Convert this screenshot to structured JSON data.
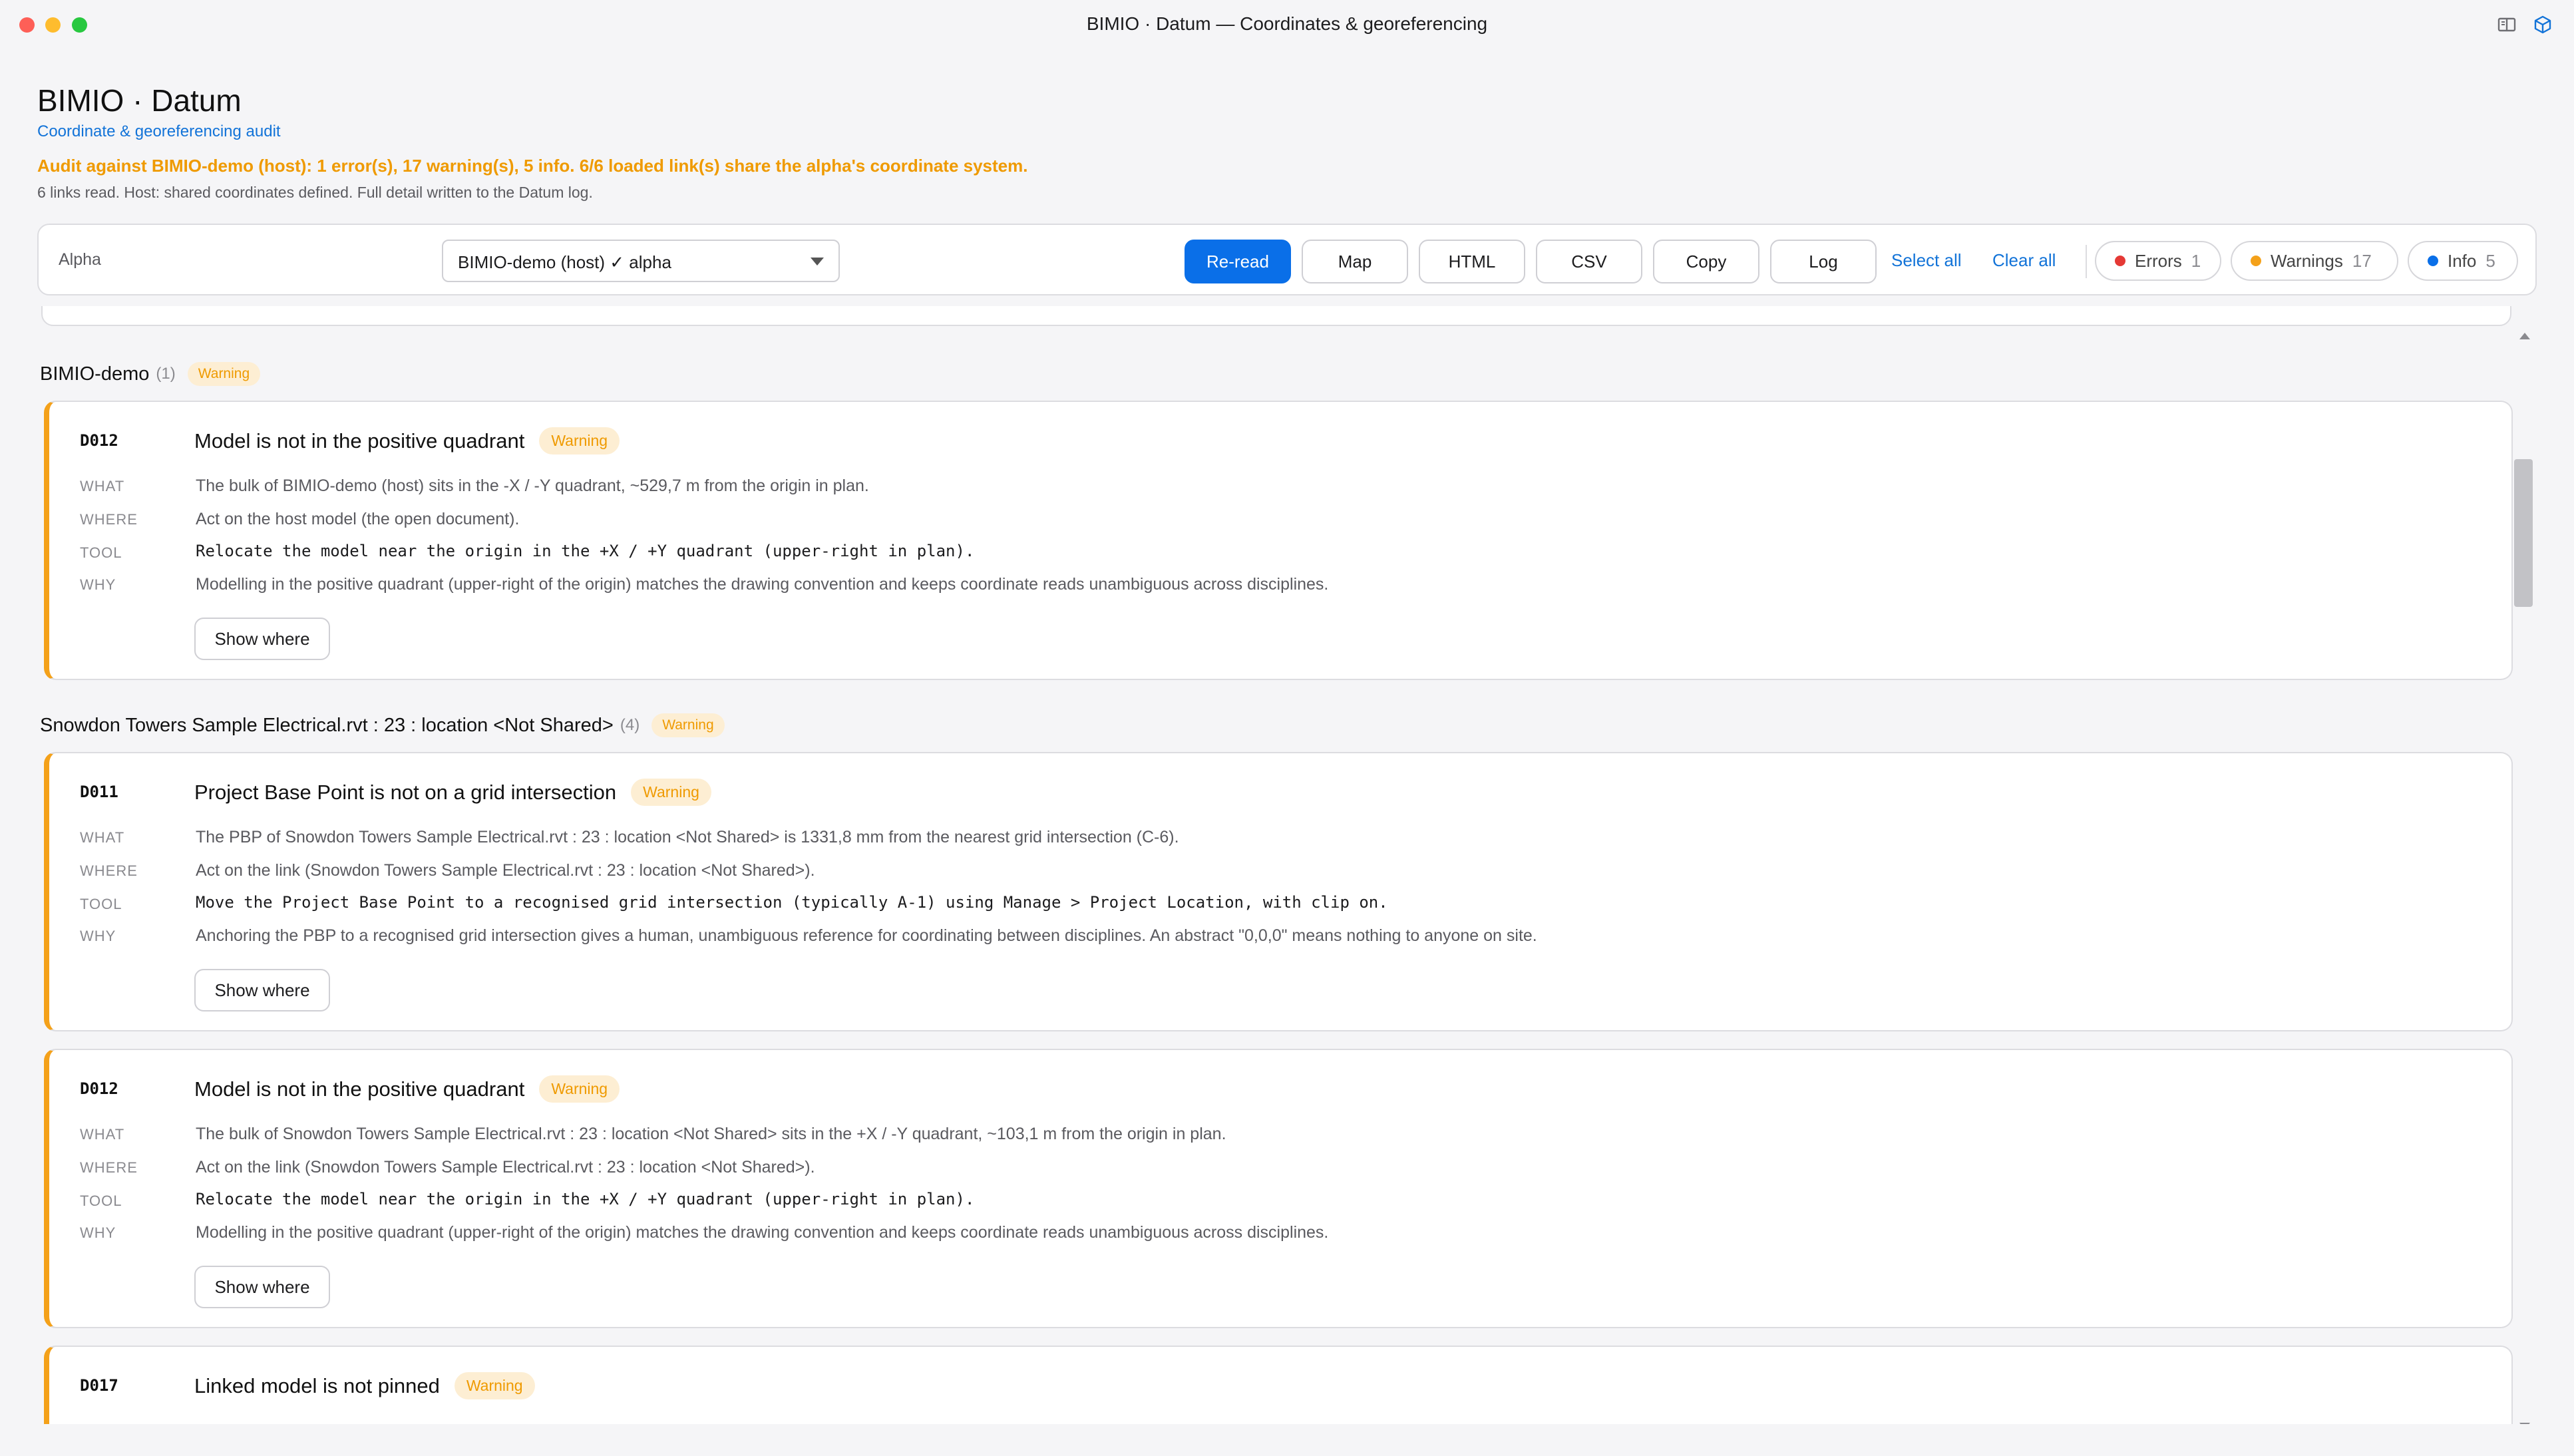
{
  "window": {
    "title": "BIMIO · Datum — Coordinates & georeferencing"
  },
  "header": {
    "title": "BIMIO · Datum",
    "subtitle": "Coordinate & georeferencing audit",
    "audit": "Audit against BIMIO-demo (host): 1 error(s), 17 warning(s), 5 info. 6/6 loaded link(s) share the alpha's coordinate system.",
    "read": "6 links read. Host: shared coordinates defined. Full detail written to the Datum log."
  },
  "toolbar": {
    "alpha_label": "Alpha",
    "alpha_value": "BIMIO-demo (host)  ✓ alpha",
    "buttons": {
      "reread": "Re-read",
      "map": "Map",
      "html": "HTML",
      "csv": "CSV",
      "copy": "Copy",
      "log": "Log"
    },
    "select_all": "Select all",
    "clear_all": "Clear all",
    "filters": {
      "errors": {
        "label": "Errors",
        "count": "1",
        "color": "#e53935"
      },
      "warnings": {
        "label": "Warnings",
        "count": "17",
        "color": "#f4a11a"
      },
      "info": {
        "label": "Info",
        "count": "5",
        "color": "#0a6fe8"
      }
    }
  },
  "labels": {
    "what": "WHAT",
    "where": "WHERE",
    "tool": "TOOL",
    "why": "WHY",
    "show_where": "Show where"
  },
  "groups": [
    {
      "name": "BIMIO-demo",
      "count": "(1)",
      "badge": "Warning"
    },
    {
      "name": "Snowdon Towers Sample Electrical.rvt : 23 : location <Not Shared>",
      "count": "(4)",
      "badge": "Warning"
    }
  ],
  "cards": [
    {
      "code": "D012",
      "title": "Model is not in the positive quadrant",
      "badge": "Warning",
      "what": "The bulk of BIMIO-demo (host) sits in the -X / -Y quadrant, ~529,7 m from the origin in plan.",
      "where": "Act on the host model (the open document).",
      "tool": "Relocate the model near the origin in the +X / +Y quadrant (upper-right in plan).",
      "why": "Modelling in the positive quadrant (upper-right of the origin) matches the drawing convention and keeps coordinate reads unambiguous across disciplines."
    },
    {
      "code": "D011",
      "title": "Project Base Point is not on a grid intersection",
      "badge": "Warning",
      "what": "The PBP of Snowdon Towers Sample Electrical.rvt : 23 : location <Not Shared> is 1331,8 mm from the nearest grid intersection (C-6).",
      "where": "Act on the link (Snowdon Towers Sample Electrical.rvt : 23 : location <Not Shared>).",
      "tool": "Move the Project Base Point to a recognised grid intersection (typically A-1) using Manage > Project Location, with clip on.",
      "why": "Anchoring the PBP to a recognised grid intersection gives a human, unambiguous reference for coordinating between disciplines. An abstract \"0,0,0\" means nothing to anyone on site."
    },
    {
      "code": "D012",
      "title": "Model is not in the positive quadrant",
      "badge": "Warning",
      "what": "The bulk of Snowdon Towers Sample Electrical.rvt : 23 : location <Not Shared> sits in the +X / -Y quadrant, ~103,1 m from the origin in plan.",
      "where": "Act on the link (Snowdon Towers Sample Electrical.rvt : 23 : location <Not Shared>).",
      "tool": "Relocate the model near the origin in the +X / +Y quadrant (upper-right in plan).",
      "why": "Modelling in the positive quadrant (upper-right of the origin) matches the drawing convention and keeps coordinate reads unambiguous across disciplines."
    },
    {
      "code": "D017",
      "title": "Linked model is not pinned",
      "badge": "Warning"
    }
  ]
}
